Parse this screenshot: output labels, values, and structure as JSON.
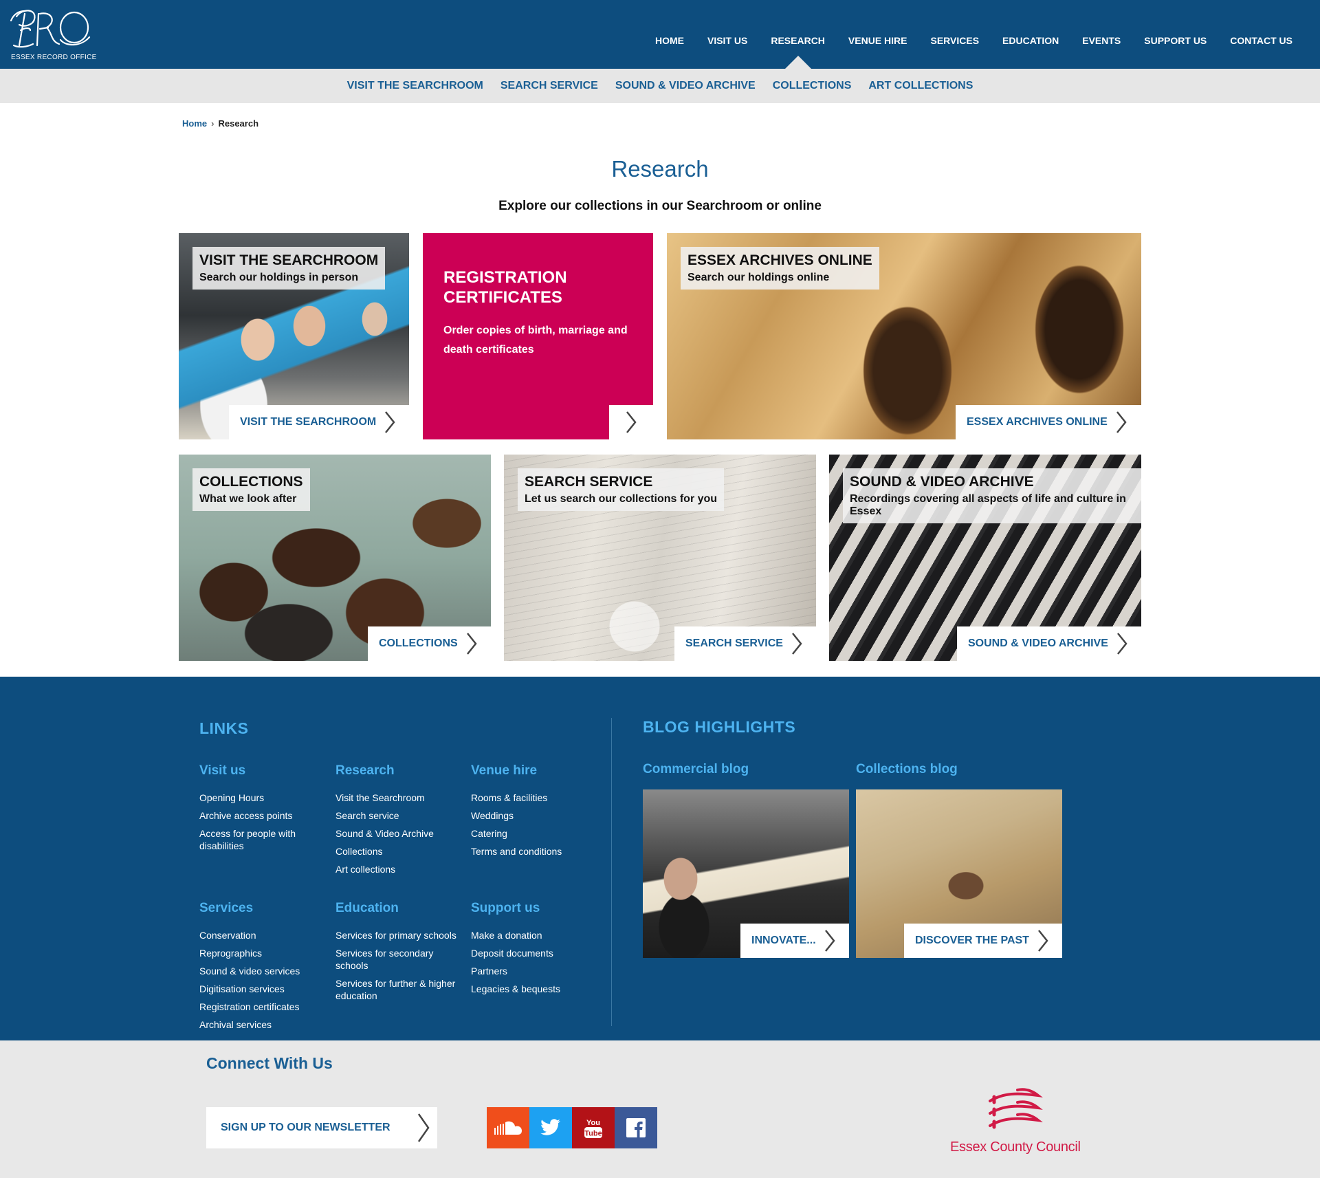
{
  "brand": {
    "logo_monogram": "ERO",
    "logo_text": "ESSEX RECORD OFFICE"
  },
  "main_nav": [
    {
      "label": "HOME"
    },
    {
      "label": "VISIT US"
    },
    {
      "label": "RESEARCH",
      "active": true
    },
    {
      "label": "VENUE HIRE"
    },
    {
      "label": "SERVICES"
    },
    {
      "label": "EDUCATION"
    },
    {
      "label": "EVENTS"
    },
    {
      "label": "SUPPORT US"
    },
    {
      "label": "CONTACT US"
    }
  ],
  "sub_nav": [
    {
      "label": "VISIT THE SEARCHROOM"
    },
    {
      "label": "SEARCH SERVICE"
    },
    {
      "label": "SOUND & VIDEO ARCHIVE"
    },
    {
      "label": "COLLECTIONS"
    },
    {
      "label": "ART COLLECTIONS"
    }
  ],
  "breadcrumb": {
    "home": "Home",
    "separator": "›",
    "current": "Research"
  },
  "page": {
    "title": "Research",
    "subtitle": "Explore our collections in our Searchroom or online"
  },
  "tiles": {
    "searchroom": {
      "title": "VISIT THE SEARCHROOM",
      "subtitle": "Search our holdings in person",
      "link": "VISIT THE SEARCHROOM"
    },
    "registration": {
      "title": "REGISTRATION CERTIFICATES",
      "text": "Order copies of birth, marriage and death certificates",
      "color": "#cc0055"
    },
    "archives_online": {
      "title": "ESSEX ARCHIVES ONLINE",
      "subtitle": "Search our holdings online",
      "link": "ESSEX ARCHIVES ONLINE"
    },
    "collections": {
      "title": "COLLECTIONS",
      "subtitle": "What we look after",
      "link": "COLLECTIONS"
    },
    "search_service": {
      "title": "SEARCH SERVICE",
      "subtitle": "Let us search our collections for you",
      "link": "SEARCH SERVICE"
    },
    "sound_video": {
      "title": "SOUND & VIDEO ARCHIVE",
      "subtitle": "Recordings covering all aspects of life and culture in Essex",
      "link": "SOUND & VIDEO ARCHIVE"
    }
  },
  "footer": {
    "links_heading": "LINKS",
    "blog_heading": "BLOG HIGHLIGHTS",
    "columns": [
      {
        "title": "Visit us",
        "items": [
          "Opening Hours",
          "Archive access points",
          "Access for people with disabilities"
        ]
      },
      {
        "title": "Research",
        "items": [
          "Visit the Searchroom",
          "Search service",
          "Sound & Video Archive",
          "Collections",
          "Art collections"
        ]
      },
      {
        "title": "Venue hire",
        "items": [
          "Rooms & facilities",
          "Weddings",
          "Catering",
          "Terms and conditions"
        ]
      },
      {
        "title": "Services",
        "items": [
          "Conservation",
          "Reprographics",
          "Sound & video services",
          "Digitisation services",
          "Registration certificates",
          "Archival services"
        ]
      },
      {
        "title": "Education",
        "items": [
          "Services for primary schools",
          "Services for secondary schools",
          "Services for further & higher education"
        ]
      },
      {
        "title": "Support us",
        "items": [
          "Make a donation",
          "Deposit documents",
          "Partners",
          "Legacies & bequests"
        ]
      }
    ],
    "blogs": [
      {
        "title": "Commercial blog",
        "link": "INNOVATE..."
      },
      {
        "title": "Collections blog",
        "link": "DISCOVER THE PAST"
      }
    ]
  },
  "connect": {
    "heading": "Connect With Us",
    "newsletter": "SIGN UP TO OUR NEWSLETTER",
    "social": [
      {
        "name": "soundcloud-icon",
        "color": "#f04e1b"
      },
      {
        "name": "twitter-icon",
        "color": "#1da1f2"
      },
      {
        "name": "youtube-icon",
        "color": "#b31217",
        "text": "You Tube"
      },
      {
        "name": "facebook-icon",
        "color": "#3b5998"
      }
    ],
    "council": "Essex County Council",
    "council_color": "#d11a46"
  },
  "colors": {
    "primary": "#0d4d7e",
    "link_blue": "#1a5f94",
    "footer_heading": "#4db3f0",
    "subnav_bg": "#e6e6e6"
  }
}
